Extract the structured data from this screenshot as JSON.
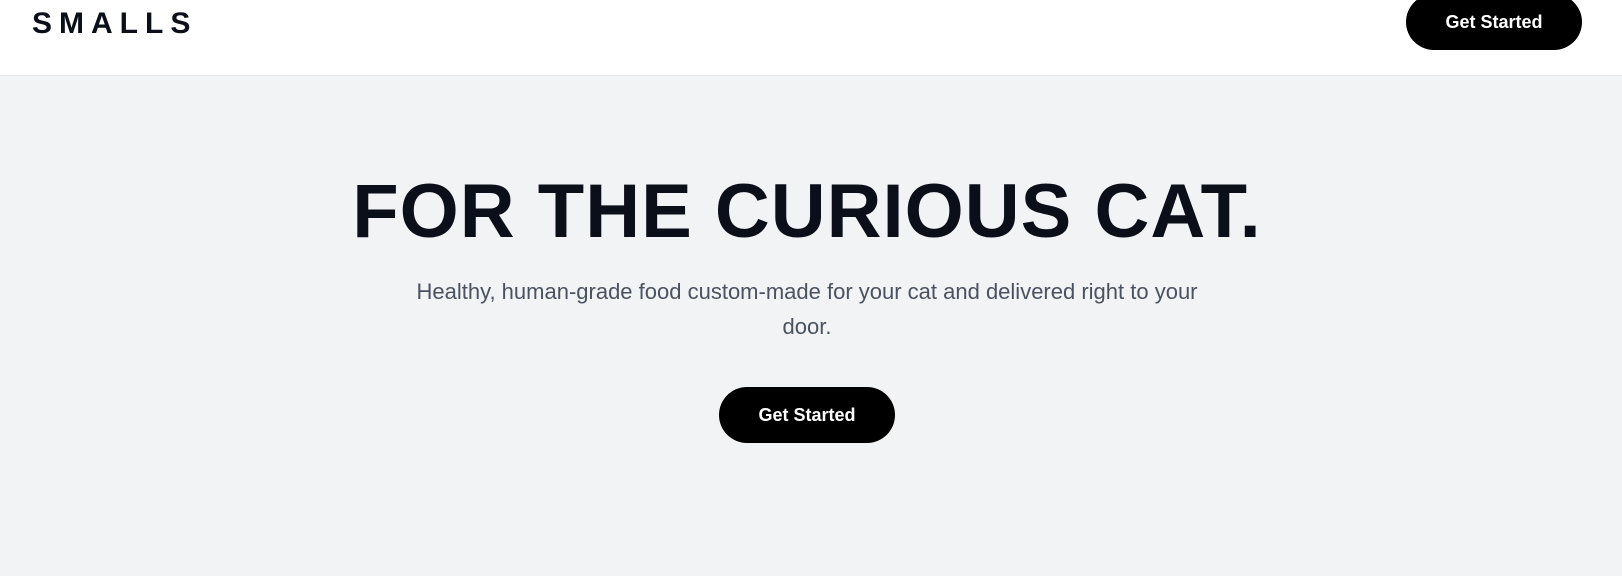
{
  "header": {
    "logo_text": "SMALLS",
    "cta_label": "Get Started"
  },
  "hero": {
    "title": "FOR THE CURIOUS CAT.",
    "subtitle": "Healthy, human-grade food custom-made for your cat and delivered right to your door.",
    "cta_label": "Get Started"
  },
  "colors": {
    "page_background": "#f2f3f5",
    "header_background": "#ffffff",
    "button_background": "#000000",
    "button_text": "#ffffff",
    "heading_text": "#0b0f1a",
    "body_text": "#4a5261"
  }
}
